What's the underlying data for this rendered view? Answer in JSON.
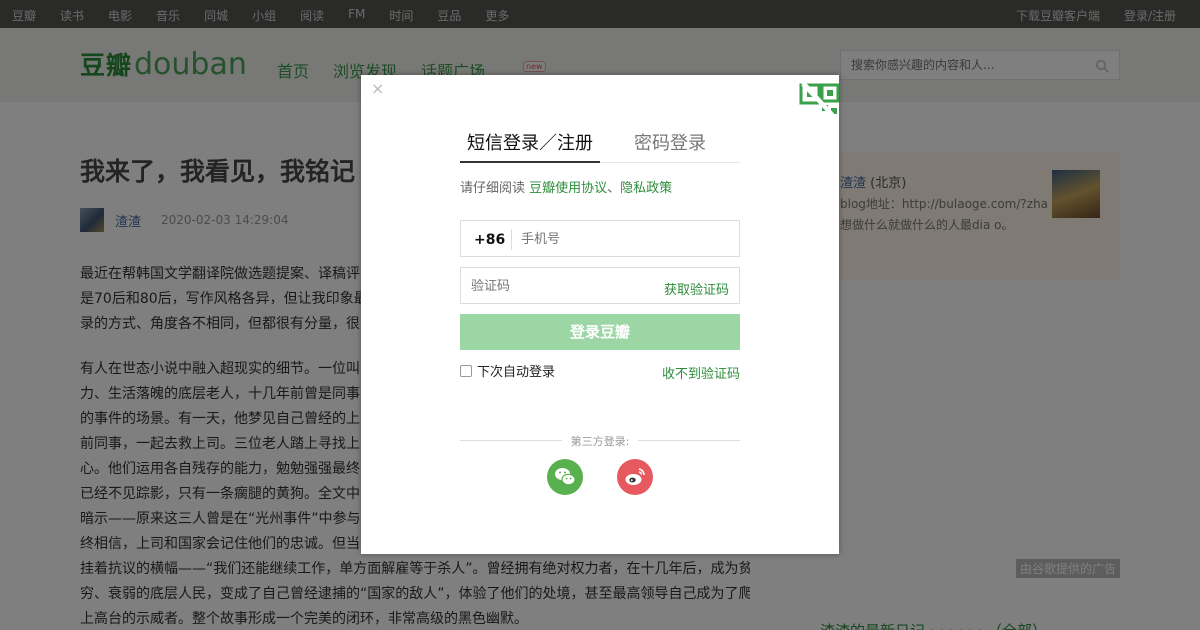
{
  "topbar": {
    "nav": [
      "豆瓣",
      "读书",
      "电影",
      "音乐",
      "同城",
      "小组",
      "阅读",
      "FM",
      "时间",
      "豆品",
      "更多"
    ],
    "download": "下载豆瓣客户端",
    "login": "登录/注册"
  },
  "header": {
    "logo_cn": "豆瓣",
    "logo_en": "douban",
    "nav": [
      "首页",
      "浏览发现",
      "话题广场"
    ],
    "new_badge": "new",
    "search_placeholder": "搜索你感兴趣的内容和人..."
  },
  "article": {
    "title": "我来了，我看见，我铭记",
    "author": "渣渣",
    "date": "2020-02-03 14:29:04",
    "para1": [
      "最近在帮韩国文学翻译院做选题提案、译稿评",
      "是70后和80后，写作风格各异，但让我印象最",
      "录的方式、角度各不相同，但都很有分量，很"
    ],
    "para2": [
      "有人在世态小说中融入超现实的细节。一位叫",
      "力、生活落魄的底层老人，十几年前曾是同事",
      "的事件的场景。有一天，他梦见自己曾经的上",
      "前同事，一起去救上司。三位老人踏上寻找上",
      "心。他们运用各自残存的能力，勉勉强强最终",
      "已经不见踪影，只有一条瘸腿的黄狗。全文中",
      "暗示——原来这三人曾是在“光州事件”中参与",
      "终相信，上司和国家会记住他们的忠诚。但当",
      "挂着抗议的横幅——“我们还能继续工作，单方面解雇等于杀人”。曾经拥有绝对权力者，在十几年后，成为贫",
      "穷、衰弱的底层人民，变成了自己曾经逮捕的“国家的敌人”，体验了他们的处境，甚至最高领导自己成为了爬",
      "上高台的示威者。整个故事形成一个完美的闭环，非常高级的黑色幽默。"
    ]
  },
  "sidebar": {
    "name": "渣渣",
    "city": "(北京)",
    "desc": "blog地址：http://bulaoge.com/?zha 想做什么就做什么的人最dia o。",
    "ad_label": "由谷歌提供的广告",
    "diary_head": "渣渣的最新日记 · · · · · · （全部）"
  },
  "modal": {
    "close": "×",
    "tab_sms": "短信登录／注册",
    "tab_password": "密码登录",
    "agree_prefix": "请仔细阅读 ",
    "agree_link1": "豆瓣使用协议",
    "agree_sep": "、",
    "agree_link2": "隐私政策",
    "country_code": "+86",
    "phone_placeholder": "手机号",
    "code_placeholder": "验证码",
    "get_code": "获取验证码",
    "submit": "登录豆瓣",
    "remember": "下次自动登录",
    "no_code": "收不到验证码",
    "third_party": "第三方登录:",
    "social_icons": [
      "wechat-icon",
      "weibo-icon"
    ]
  },
  "colors": {
    "brand_green": "#2d8d3b",
    "button_disabled": "#9dd6a5",
    "wechat": "#59b04e",
    "weibo": "#e5595f"
  }
}
